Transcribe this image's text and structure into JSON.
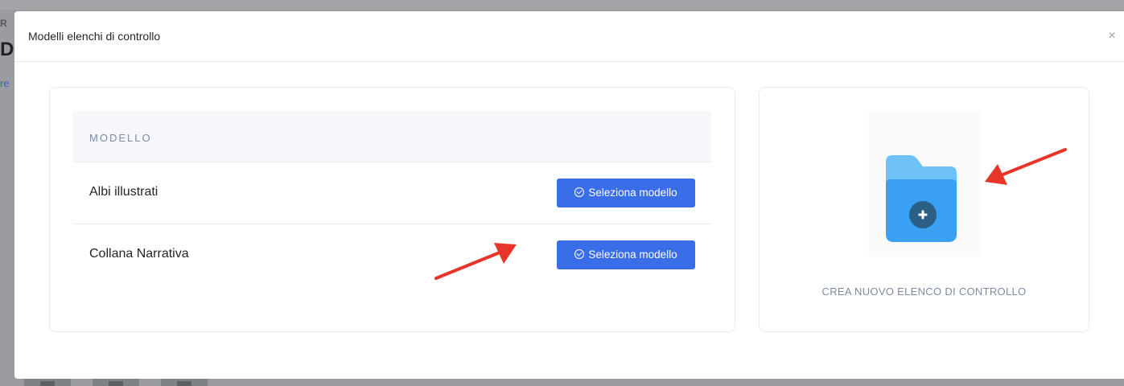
{
  "background": {
    "fragment_1": "R",
    "fragment_2": "D",
    "fragment_3": "re"
  },
  "modal": {
    "title": "Modelli elenchi di controllo",
    "close_symbol": "×"
  },
  "templates": {
    "column_header": "MODELLO",
    "rows": [
      {
        "name": "Albi illustrati",
        "button_label": "Seleziona modello"
      },
      {
        "name": "Collana Narrativa",
        "button_label": "Seleziona modello"
      }
    ]
  },
  "create": {
    "label": "CREA NUOVO ELENCO DI CONTROLLO",
    "icon": "folder-plus-icon"
  },
  "colors": {
    "accent": "#3a6ee8",
    "folder_light": "#6ec2f7",
    "folder_main": "#3aa1f2",
    "folder_plus_bg": "#2c5f85",
    "arrow": "#e8352a"
  }
}
